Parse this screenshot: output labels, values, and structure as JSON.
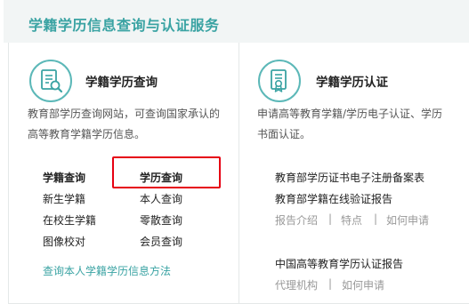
{
  "header": {
    "title": "学籍学历信息查询与认证服务"
  },
  "left_card": {
    "icon": "document-search-icon",
    "title": "学籍学历查询",
    "description_line1": "教育部学历查询网站，可查询国家承认的",
    "description_line2": "高等教育学籍学历信息。",
    "links": {
      "xueji_query": "学籍查询",
      "xueli_query": "学历查询",
      "new_student": "新生学籍",
      "personal_query": "本人查询",
      "enrolled_student": "在校生学籍",
      "zero_query": "零散查询",
      "image_check": "图像校对",
      "member_query": "会员查询"
    },
    "method_link": "查询本人学籍学历信息方法"
  },
  "right_card": {
    "icon": "certificate-icon",
    "title": "学籍学历认证",
    "description_line1": "申请高等教育学籍/学历电子认证、学历",
    "description_line2": "书面认证。",
    "links": {
      "diploma_report": "教育部学历证书电子注册备案表",
      "xueji_report": "教育部学籍在线验证报告",
      "report_intro": "报告介绍",
      "features": "特点",
      "how_apply_1": "如何申请",
      "cert_report": "中国高等教育学历认证报告",
      "agency": "代理机构",
      "how_apply_2": "如何申请"
    },
    "separator": "|"
  },
  "colors": {
    "accent": "#3aa3a3",
    "highlight": "#e60012",
    "header_bg": "#f2f5f5"
  }
}
